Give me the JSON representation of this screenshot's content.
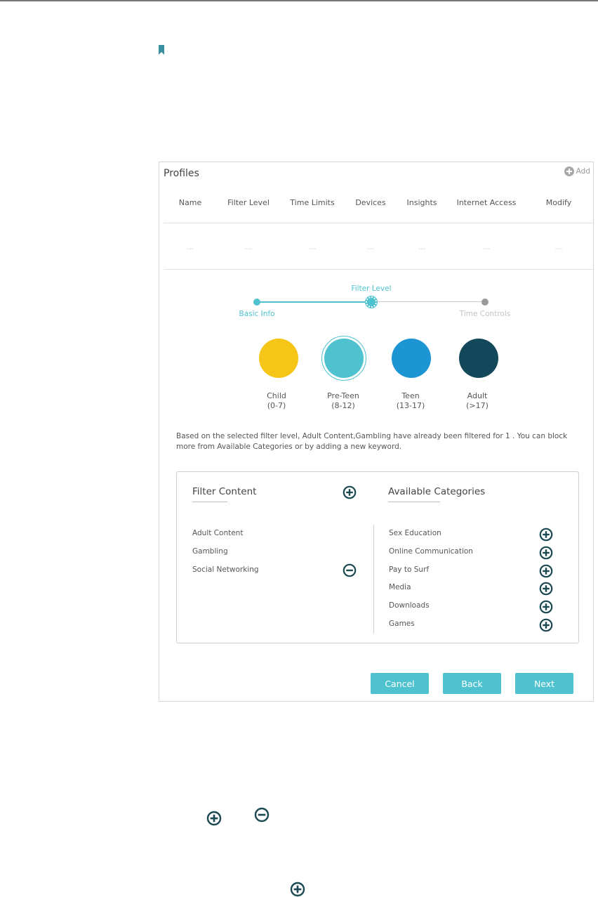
{
  "colors": {
    "accent": "#4ec2cf",
    "icon_dark": "#1c4a52",
    "child": "#f5c518",
    "preteen": "#4ec2cf",
    "teen": "#1e95d3",
    "adult": "#13475a"
  },
  "profiles": {
    "title": "Profiles",
    "add_label": "Add",
    "columns": [
      "Name",
      "Filter Level",
      "Time Limits",
      "Devices",
      "Insights",
      "Internet Access",
      "Modify"
    ],
    "row": [
      "---",
      "---",
      "---",
      "---",
      "---",
      "---",
      "---"
    ]
  },
  "wizard": {
    "steps": {
      "basic": "Basic Info",
      "filter": "Filter Level",
      "time": "Time Controls"
    },
    "current_step": "Filter Level"
  },
  "filter_levels": [
    {
      "name": "Child",
      "range": "(0-7)",
      "color": "#f5c518"
    },
    {
      "name": "Pre-Teen",
      "range": "(8-12)",
      "color": "#4ec2cf"
    },
    {
      "name": "Teen",
      "range": "(13-17)",
      "color": "#1e95d3"
    },
    {
      "name": "Adult",
      "range": "(>17)",
      "color": "#13475a"
    }
  ],
  "selected_level": "Pre-Teen",
  "info_text": "Based on the selected filter level, Adult Content,Gambling have already been filtered for 1 . You can block more from Available Categories or by adding a new keyword.",
  "filter_content": {
    "title": "Filter Content",
    "items": [
      "Adult Content",
      "Gambling",
      "Social Networking"
    ],
    "add_icon": "plus-circle-icon",
    "remove_icon": "minus-circle-icon"
  },
  "available_categories": {
    "title": "Available Categories",
    "items": [
      "Sex Education",
      "Online Communication",
      "Pay to Surf",
      "Media",
      "Downloads",
      "Games"
    ],
    "add_icon": "plus-circle-icon"
  },
  "buttons": {
    "cancel": "Cancel",
    "back": "Back",
    "next": "Next"
  }
}
